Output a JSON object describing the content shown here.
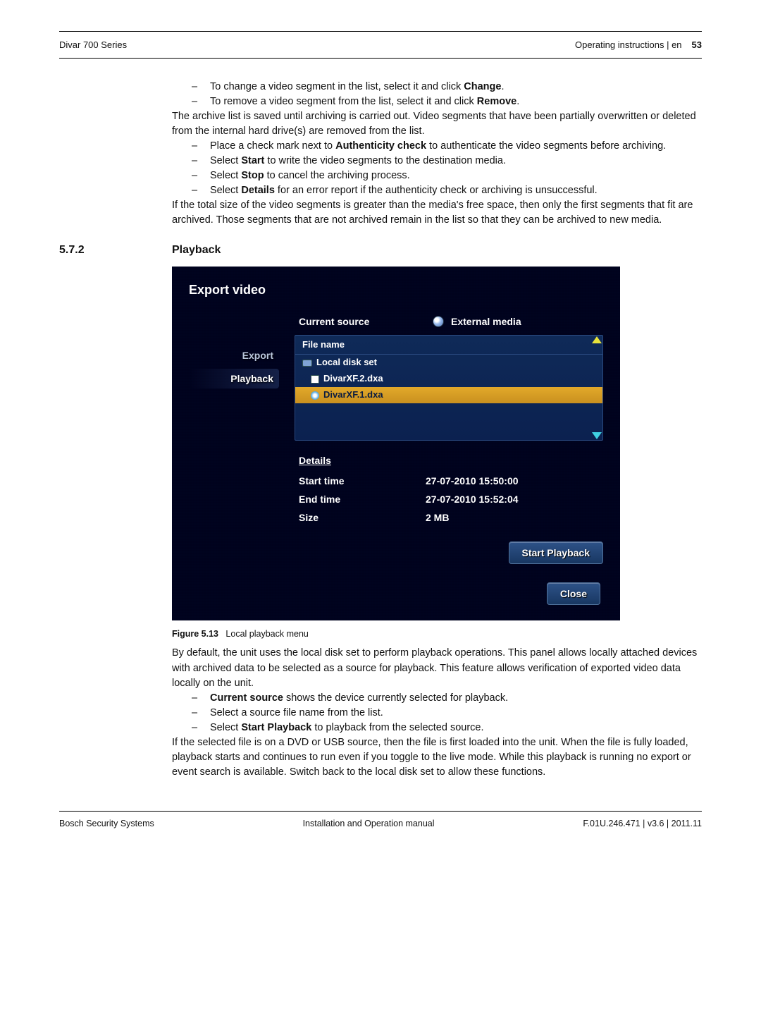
{
  "header": {
    "product": "Divar 700 Series",
    "right_text": "Operating instructions | en",
    "page_number": "53"
  },
  "top_block": {
    "bullet1_pre": "To change a video segment in the list, select it and click ",
    "bullet1_bold": "Change",
    "bullet2_pre": "To remove a video segment from the list, select it and click ",
    "bullet2_bold": "Remove",
    "para1": "The archive list is saved until archiving is carried out. Video segments that have been partially overwritten or deleted from the internal hard drive(s) are removed from the list.",
    "bullet3_pre": "Place a check mark next to ",
    "bullet3_bold": "Authenticity check",
    "bullet3_post": " to authenticate the video segments before archiving.",
    "bullet4_pre": "Select ",
    "bullet4_bold": "Start",
    "bullet4_post": " to write the video segments to the destination media.",
    "bullet5_pre": "Select ",
    "bullet5_bold": "Stop",
    "bullet5_post": " to cancel the archiving process.",
    "bullet6_pre": "Select ",
    "bullet6_bold": "Details",
    "bullet6_post": " for an error report if the authenticity check or archiving is unsuccessful.",
    "para2": "If the total size of the video segments is greater than the media's free space, then only the first segments that fit are archived. Those segments that are not archived remain in the list so that they can be archived to new media."
  },
  "section": {
    "num": "5.7.2",
    "title": "Playback"
  },
  "screenshot": {
    "title": "Export video",
    "current_source_label": "Current source",
    "current_source_value": "External media",
    "tabs": {
      "export": "Export",
      "playback": "Playback"
    },
    "file_header": "File name",
    "files": {
      "root": "Local disk set",
      "f1": "DivarXF.2.dxa",
      "f2": "DivarXF.1.dxa"
    },
    "details_title": "Details",
    "start_time_label": "Start time",
    "start_time_value": "27-07-2010 15:50:00",
    "end_time_label": "End time",
    "end_time_value": "27-07-2010 15:52:04",
    "size_label": "Size",
    "size_value": "2 MB",
    "start_playback_btn": "Start Playback",
    "close_btn": "Close"
  },
  "figure": {
    "label": "Figure 5.13",
    "caption": "Local playback menu"
  },
  "bottom_block": {
    "para1": "By default, the unit uses the local disk set to perform playback operations. This panel allows locally attached devices with archived data to be selected as a source for playback. This feature allows verification of exported video data locally on the unit.",
    "bullet1_bold": "Current source",
    "bullet1_post": " shows the device currently selected for playback.",
    "bullet2": "Select a source file name from the list.",
    "bullet3_pre": "Select ",
    "bullet3_bold": "Start Playback",
    "bullet3_post": " to playback from the selected source.",
    "para2": "If the selected file is on a DVD or USB source, then the file is first loaded into the unit. When the file is fully loaded, playback starts and continues to run even if you toggle to the live mode. While this playback is running no export or event search is available. Switch back to the local disk set to allow these functions."
  },
  "footer": {
    "left": "Bosch Security Systems",
    "center": "Installation and Operation manual",
    "right": "F.01U.246.471 | v3.6 | 2011.11"
  }
}
